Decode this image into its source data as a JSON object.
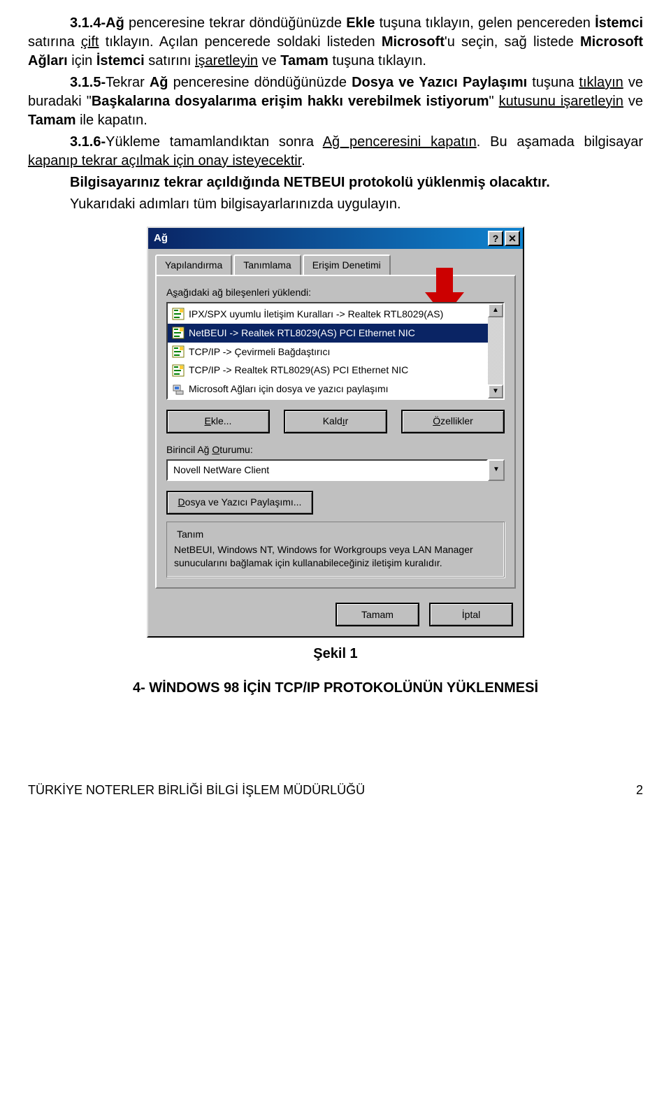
{
  "doc": {
    "p314": {
      "num": "3.1.4-",
      "word_ag": "Ağ",
      "t1": " penceresine tekrar döndüğünüzde ",
      "ekle": "Ekle",
      "t2": " tuşuna tıklayın, gelen pencereden ",
      "istemci": "İstemci",
      "t3": " satırına ",
      "cift": "çift",
      "t4": " tıklayın. Açılan pencerede soldaki listeden ",
      "microsoft": "Microsoft",
      "t5": "'u seçin, sağ listede ",
      "ms_aglari": "Microsoft Ağları",
      "icin": " için ",
      "istemci2": "İstemci",
      "t6": " satırını ",
      "isaretleyin": "işaretleyin",
      "t7": " ve ",
      "tamam": "Tamam",
      "t8": " tuşuna tıklayın."
    },
    "p315": {
      "num": "3.1.5-",
      "t1": "Tekrar ",
      "ag": "Ağ",
      "t2": " penceresine döndüğünüzde ",
      "dosya": "Dosya ve Yazıcı Paylaşımı",
      "t3": " tuşuna ",
      "tiklayin": "tıklayın",
      "t4": " ve buradaki \"",
      "baskalari": "Başkalarına dosyalarıma erişim hakkı verebilmek istiyorum",
      "t5": "\" ",
      "kutusunu": "kutusunu işaretleyin",
      "t6": " ve ",
      "tamam": "Tamam",
      "t7": " ile kapatın."
    },
    "p316": {
      "num": "3.1.6-",
      "t1": "Yükleme tamamlandıktan sonra ",
      "ag": "Ağ penceresini kapatın",
      "t2": ". Bu aşamada bilgisayar ",
      "kapanip": "kapanıp tekrar açılmak için onay isteyecektir",
      "t3": "."
    },
    "p317": "Bilgisayarınız tekrar açıldığında NETBEUI protokolü yüklenmiş olacaktır.",
    "p318": "Yukarıdaki adımları tüm bilgisayarlarınızda uygulayın.",
    "figcap": "Şekil 1",
    "section4": "4- WİNDOWS 98 İÇİN TCP/IP PROTOKOLÜNÜN YÜKLENMESİ",
    "footer_org": "TÜRKİYE NOTERLER BİRLİĞİ BİLGİ İŞLEM MÜDÜRLÜĞÜ",
    "footer_page": "2"
  },
  "dialog": {
    "title": "Ağ",
    "help_char": "?",
    "close_char": "✕",
    "tabs": [
      "Yapılandırma",
      "Tanımlama",
      "Erişim Denetimi"
    ],
    "list_label_pre": "A",
    "list_label_ul": "ş",
    "list_label_post": "ağıdaki ağ bileşenleri yüklendi:",
    "items": [
      "IPX/SPX uyumlu İletişim Kuralları -> Realtek RTL8029(AS)",
      "NetBEUI -> Realtek RTL8029(AS) PCI Ethernet NIC",
      "TCP/IP -> Çevirmeli Bağdaştırıcı",
      "TCP/IP -> Realtek RTL8029(AS) PCI Ethernet NIC",
      "Microsoft Ağları için dosya ve yazıcı paylaşımı"
    ],
    "scroll_up": "▲",
    "scroll_down": "▼",
    "btn_ekle_ul": "E",
    "btn_ekle_rest": "kle...",
    "btn_kaldir_pre": "Kald",
    "btn_kaldir_ul": "ı",
    "btn_kaldir_post": "r",
    "btn_ozellikler_ul": "Ö",
    "btn_ozellikler_rest": "zellikler",
    "primary_label_pre": "Birincil Ağ ",
    "primary_label_ul": "O",
    "primary_label_post": "turumu:",
    "primary_value": "Novell NetWare Client",
    "combo_arrow": "▼",
    "fileprint_ul": "D",
    "fileprint_rest": "osya ve Yazıcı Paylaşımı...",
    "fieldset_legend": "Tanım",
    "fieldset_text": "NetBEUI, Windows NT, Windows for Workgroups veya LAN Manager sunucularını bağlamak için kullanabileceğiniz iletişim kuralıdır.",
    "btn_tamam": "Tamam",
    "btn_iptal": "İptal"
  }
}
